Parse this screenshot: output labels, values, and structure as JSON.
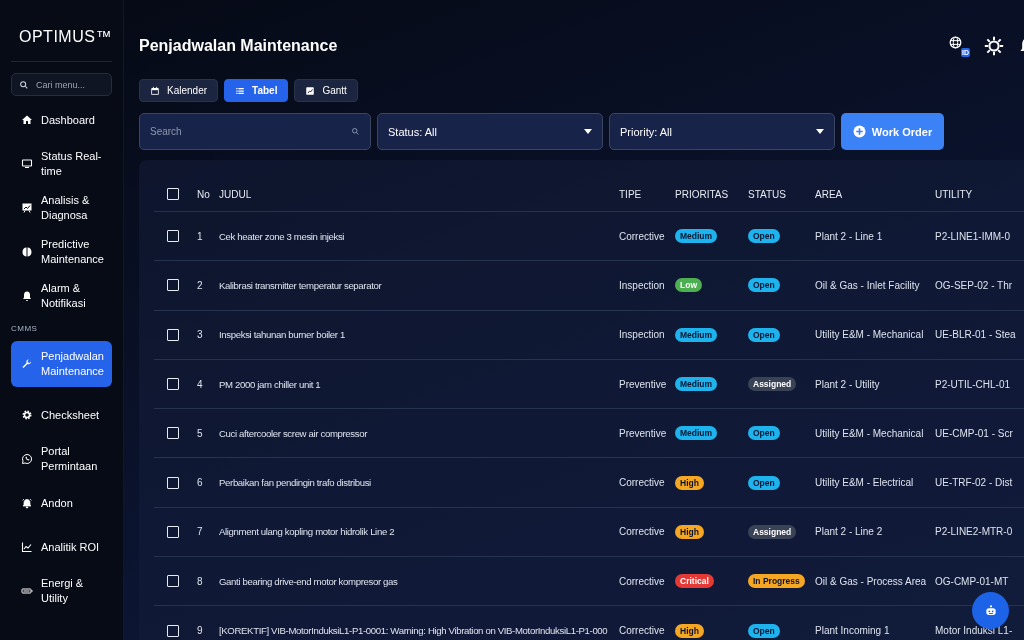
{
  "sidebar": {
    "logo": "OPTIMUS™",
    "search": {
      "placeholder": "Cari menu..."
    },
    "items": [
      {
        "label": "Dashboard",
        "selected": false
      },
      {
        "label": "Status Real-time",
        "selected": false
      },
      {
        "label": "Analisis & Diagnosa",
        "selected": false
      },
      {
        "label": "Predictive Maintenance",
        "selected": false
      },
      {
        "label": "Alarm & Notifikasi",
        "selected": false
      }
    ],
    "section": {
      "label": "CMMS",
      "items": [
        {
          "label": "Penjadwalan Maintenance",
          "selected": true
        },
        {
          "label": "Checksheet",
          "selected": false
        },
        {
          "label": "Portal Permintaan",
          "selected": false
        },
        {
          "label": "Andon",
          "selected": false
        },
        {
          "label": "Analitik ROI",
          "selected": false
        },
        {
          "label": "Energi & Utility",
          "selected": false
        }
      ]
    }
  },
  "header": {
    "title": "Penjadwalan Maintenance",
    "language_badge": "ID"
  },
  "view_tabs": [
    {
      "label": "Kalender",
      "selected": false
    },
    {
      "label": "Tabel",
      "selected": true
    },
    {
      "label": "Gantt",
      "selected": false
    }
  ],
  "filters": {
    "search": {
      "placeholder": "Search"
    },
    "status": "Status: All",
    "priority": "Priority: All",
    "button": "Work Order"
  },
  "table": {
    "header_checked": false,
    "columns": [
      "No",
      "JUDUL",
      "TIPE",
      "PRIORITAS",
      "STATUS",
      "AREA",
      "UTILITY"
    ],
    "rows": [
      {
        "checked": false,
        "no": "1",
        "title": "Cek heater zone 3 mesin injeksi",
        "type": "Corrective",
        "priority": {
          "label": "Medium",
          "color": "#1fb3ee"
        },
        "status": {
          "label": "Open",
          "color": "#1fb3ee"
        },
        "area": "Plant 2 - Line 1",
        "utility": "P2-LINE1-IMM-0"
      },
      {
        "checked": false,
        "no": "2",
        "title": "Kalibrasi transmitter temperatur separator",
        "type": "Inspection",
        "priority": {
          "label": "Low",
          "color": "#4caf50"
        },
        "status": {
          "label": "Open",
          "color": "#1fb3ee"
        },
        "area": "Oil & Gas - Inlet Facility",
        "utility": "OG-SEP-02 - Thr"
      },
      {
        "checked": false,
        "no": "3",
        "title": "Inspeksi tahunan burner boiler 1",
        "type": "Inspection",
        "priority": {
          "label": "Medium",
          "color": "#1fb3ee"
        },
        "status": {
          "label": "Open",
          "color": "#1fb3ee"
        },
        "area": "Utility E&M - Mechanical",
        "utility": "UE-BLR-01 - Stea"
      },
      {
        "checked": false,
        "no": "4",
        "title": "PM 2000 jam chiller unit 1",
        "type": "Preventive",
        "priority": {
          "label": "Medium",
          "color": "#1fb3ee"
        },
        "status": {
          "label": "Assigned",
          "color": "#3a4256"
        },
        "area": "Plant 2 - Utility",
        "utility": "P2-UTIL-CHL-01"
      },
      {
        "checked": false,
        "no": "5",
        "title": "Cuci aftercooler screw air compressor",
        "type": "Preventive",
        "priority": {
          "label": "Medium",
          "color": "#1fb3ee"
        },
        "status": {
          "label": "Open",
          "color": "#1fb3ee"
        },
        "area": "Utility E&M - Mechanical",
        "utility": "UE-CMP-01 - Scr"
      },
      {
        "checked": false,
        "no": "6",
        "title": "Perbaikan fan pendingin trafo distribusi",
        "type": "Corrective",
        "priority": {
          "label": "High",
          "color": "#f5a623"
        },
        "status": {
          "label": "Open",
          "color": "#1fb3ee"
        },
        "area": "Utility E&M - Electrical",
        "utility": "UE-TRF-02 - Dist"
      },
      {
        "checked": false,
        "no": "7",
        "title": "Alignment ulang kopling motor hidrolik Line 2",
        "type": "Corrective",
        "priority": {
          "label": "High",
          "color": "#f5a623"
        },
        "status": {
          "label": "Assigned",
          "color": "#3a4256"
        },
        "area": "Plant 2 - Line 2",
        "utility": "P2-LINE2-MTR-0"
      },
      {
        "checked": false,
        "no": "8",
        "title": "Ganti bearing drive-end motor kompresor gas",
        "type": "Corrective",
        "priority": {
          "label": "Critical",
          "color": "#e53935"
        },
        "status": {
          "label": "In Progress",
          "color": "#f5a623"
        },
        "area": "Oil & Gas - Process Area",
        "utility": "OG-CMP-01-MT"
      },
      {
        "checked": false,
        "no": "9",
        "title": "[KOREKTIF] VIB-MotorInduksiL1-P1-0001: Warning: High Vibration on VIB-MotorInduksiL1-P1-000",
        "type": "Corrective",
        "priority": {
          "label": "High",
          "color": "#f5a623"
        },
        "status": {
          "label": "Open",
          "color": "#1fb3ee"
        },
        "area": "Plant Incoming 1",
        "utility": "Motor Induksi L1-"
      }
    ]
  }
}
